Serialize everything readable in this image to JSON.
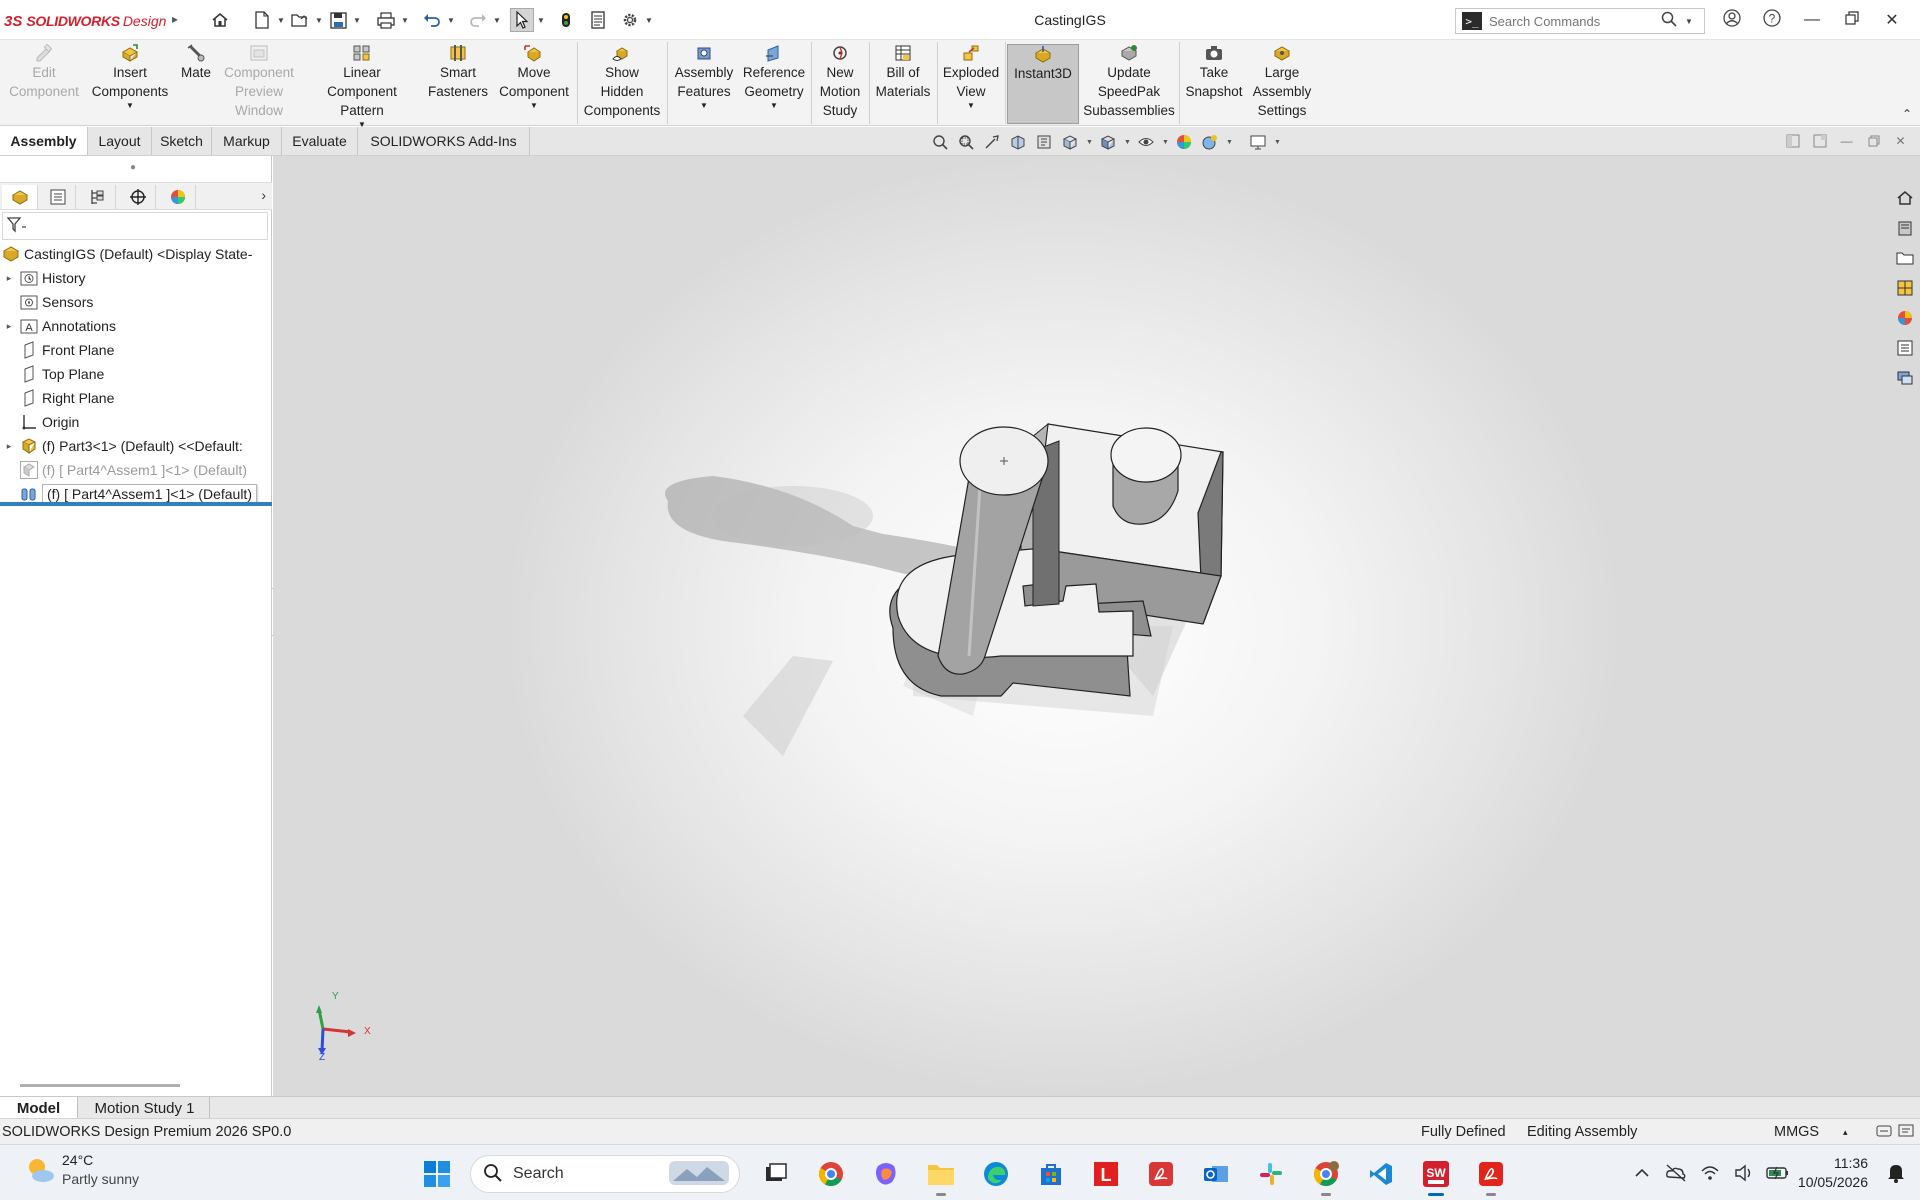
{
  "app": {
    "brand_ds": "3S",
    "brand": "SOLIDWORKS",
    "brand_suffix": "Design",
    "document_title": "CastingIGS"
  },
  "search": {
    "placeholder": "Search Commands"
  },
  "ribbon": {
    "buttons": [
      {
        "label": "Edit Component",
        "enabled": false,
        "icon": "edit-component-icon"
      },
      {
        "label": "Insert Components",
        "enabled": true,
        "icon": "insert-components-icon"
      },
      {
        "label": "Mate",
        "enabled": true,
        "icon": "mate-icon"
      },
      {
        "label": "Component Preview Window",
        "enabled": false,
        "icon": "component-preview-icon"
      },
      {
        "label": "Linear Component Pattern",
        "enabled": true,
        "icon": "linear-pattern-icon"
      },
      {
        "label": "Smart Fasteners",
        "enabled": true,
        "icon": "smart-fasteners-icon"
      },
      {
        "label": "Move Component",
        "enabled": true,
        "icon": "move-component-icon"
      },
      {
        "label": "Show Hidden Components",
        "enabled": true,
        "icon": "show-hidden-icon"
      },
      {
        "label": "Assembly Features",
        "enabled": true,
        "icon": "assembly-features-icon"
      },
      {
        "label": "Reference Geometry",
        "enabled": true,
        "icon": "reference-geometry-icon"
      },
      {
        "label": "New Motion Study",
        "enabled": true,
        "icon": "motion-study-icon"
      },
      {
        "label": "Bill of Materials",
        "enabled": true,
        "icon": "bom-icon"
      },
      {
        "label": "Exploded View",
        "enabled": true,
        "icon": "exploded-view-icon"
      },
      {
        "label": "Instant3D",
        "enabled": true,
        "active": true,
        "icon": "instant3d-icon"
      },
      {
        "label": "Update SpeedPak Subassemblies",
        "enabled": true,
        "icon": "speedpak-icon"
      },
      {
        "label": "Take Snapshot",
        "enabled": true,
        "icon": "snapshot-icon"
      },
      {
        "label": "Large Assembly Settings",
        "enabled": true,
        "icon": "large-assembly-icon"
      }
    ]
  },
  "tabs": [
    "Assembly",
    "Layout",
    "Sketch",
    "Markup",
    "Evaluate",
    "SOLIDWORKS Add-Ins"
  ],
  "tree": {
    "root": "CastingIGS (Default) <Display State-",
    "items": [
      {
        "label": "History",
        "expandable": true,
        "icon": "history-icon"
      },
      {
        "label": "Sensors",
        "expandable": false,
        "icon": "sensors-icon"
      },
      {
        "label": "Annotations",
        "expandable": true,
        "icon": "annotations-icon"
      },
      {
        "label": "Front Plane",
        "expandable": false,
        "icon": "plane-icon"
      },
      {
        "label": "Top Plane",
        "expandable": false,
        "icon": "plane-icon"
      },
      {
        "label": "Right Plane",
        "expandable": false,
        "icon": "plane-icon"
      },
      {
        "label": "Origin",
        "expandable": false,
        "icon": "origin-icon"
      },
      {
        "label": "(f) Part3<1> (Default) <<Default:",
        "expandable": true,
        "icon": "part-icon"
      },
      {
        "label": "(f) [ Part4^Assem1 ]<1> (Default)",
        "expandable": false,
        "icon": "virtual-part-icon",
        "dim": true
      },
      {
        "label": "(f) [ Part4^Assem1 ]<1> (Default)",
        "expandable": false,
        "icon": "mates-icon",
        "tooltip": true
      }
    ]
  },
  "bottom_tabs": [
    "Model",
    "Motion Study 1"
  ],
  "status": {
    "product": "SOLIDWORKS Design Premium 2026 SP0.0",
    "definition": "Fully Defined",
    "mode": "Editing Assembly",
    "units": "MMGS"
  },
  "axis_labels": {
    "x": "X",
    "y": "Y",
    "z": "Z"
  },
  "taskbar": {
    "temperature": "24°C",
    "condition": "Partly sunny",
    "search_label": "Search",
    "time": "11:36",
    "date": "10/05/2026"
  },
  "colors": {
    "brand": "#d3202f",
    "selection_blue": "#2f7fc1",
    "active_button": "#c7c7c7"
  }
}
